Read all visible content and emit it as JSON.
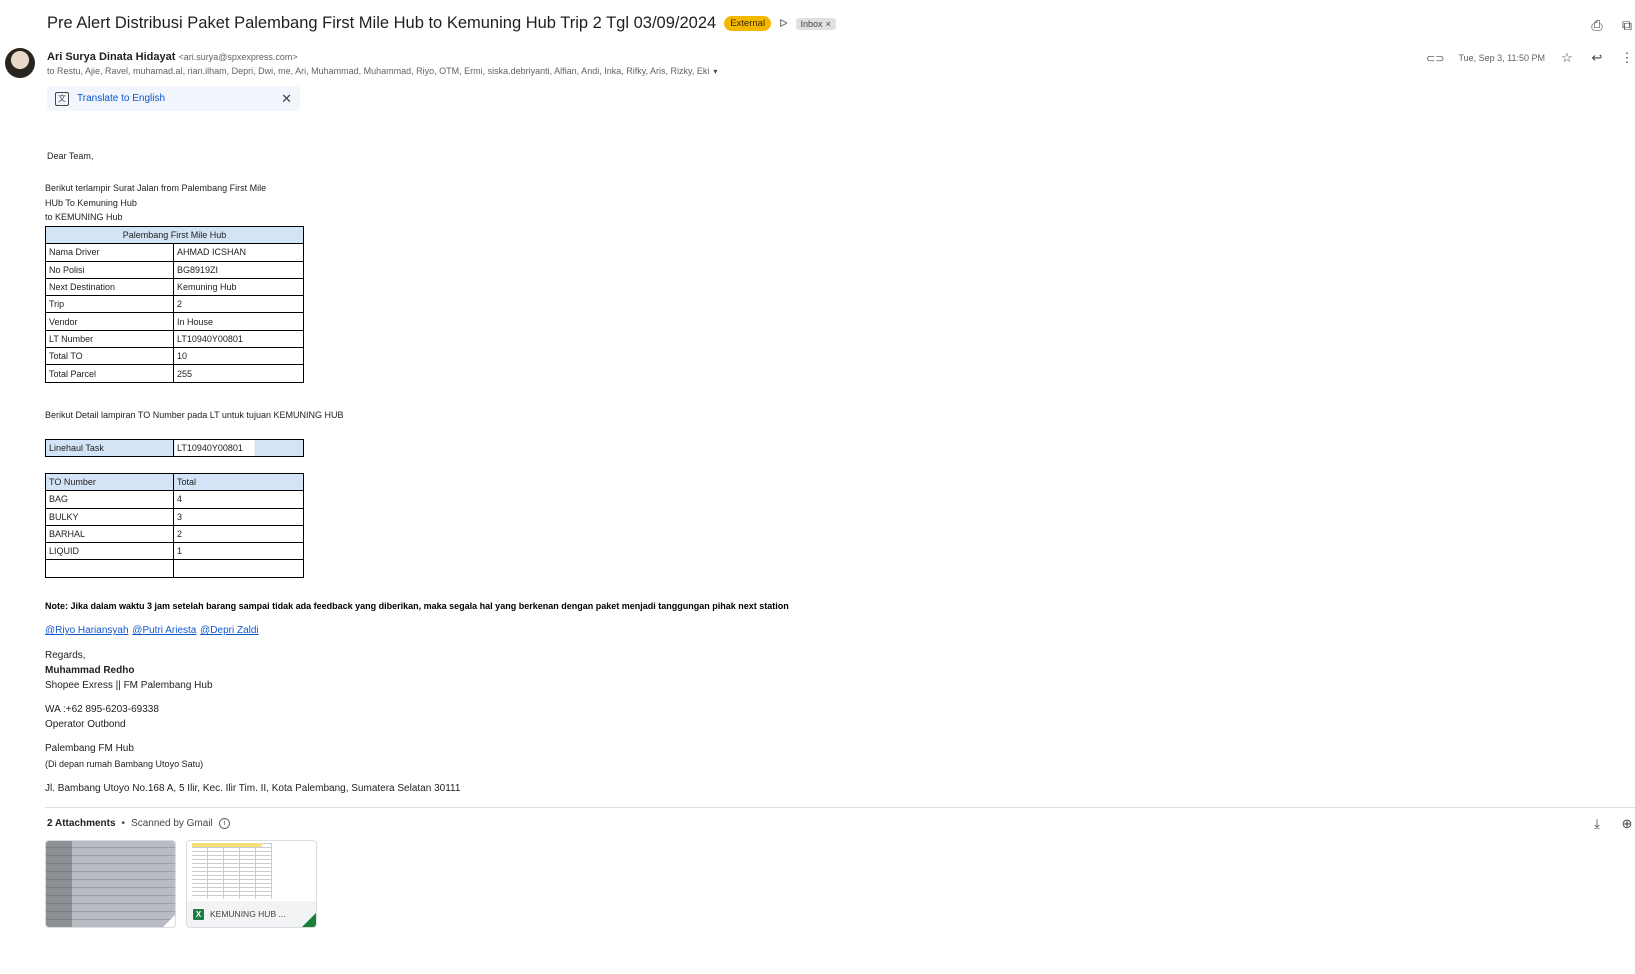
{
  "email": {
    "subject": "Pre Alert Distribusi Paket Palembang First Mile Hub to Kemuning Hub Trip 2 Tgl 03/09/2024",
    "labels": {
      "external": "External",
      "inbox": "Inbox",
      "inbox_close": "×"
    },
    "sender_name": "Ari Surya Dinata Hidayat",
    "sender_email": "<ari.surya@spxexpress.com>",
    "recipients": "to Restu, Ajie, Ravel, muhamad.al, rian.ilham, Depri, Dwi, me, Ari, Muhammad, Muhammad, Riyo, OTM, Ermi, siska.debriyanti, Alfian, Andi, Inka, Rifky, Aris, Rizky, Eki",
    "date": "Tue, Sep 3, 11:50 PM"
  },
  "translate": {
    "label": "Translate to English",
    "close": "✕"
  },
  "body": {
    "greeting": "Dear Team,",
    "intro_lines": [
      "Berikut terlampir Surat Jalan from Palembang First Mile",
      "HUb To Kemuning Hub",
      "to KEMUNING  Hub"
    ],
    "info_table": {
      "header": "Palembang First Mile Hub",
      "rows": [
        {
          "label": "Nama Driver",
          "value": "AHMAD ICSHAN"
        },
        {
          "label": "No Polisi",
          "value": "BG8919ZI"
        },
        {
          "label": "Next Destination",
          "value": "Kemuning Hub"
        },
        {
          "label": "Trip",
          "value": "2"
        },
        {
          "label": "Vendor",
          "value": "In House"
        },
        {
          "label": "LT Number",
          "value": "LT10940Y00801"
        },
        {
          "label": "Total TO",
          "value": "10"
        },
        {
          "label": "Total Parcel",
          "value": "255"
        }
      ]
    },
    "detail_line": "Berikut Detail lampiran TO Number pada LT untuk tujuan KEMUNING HUB",
    "linehaul": {
      "label": "Linehaul Task",
      "value": "LT10940Y00801"
    },
    "to_table": {
      "headers": [
        "TO Number",
        "Total"
      ],
      "rows": [
        {
          "type": "BAG",
          "total": "4"
        },
        {
          "type": "BULKY",
          "total": "3"
        },
        {
          "type": "BARHAL",
          "total": "2"
        },
        {
          "type": "LIQUID",
          "total": "1"
        },
        {
          "type": "",
          "total": ""
        }
      ]
    },
    "note": "Note: Jika dalam waktu 3 jam setelah barang sampai tidak ada feedback yang diberikan, maka segala hal yang berkenan dengan paket menjadi tanggungan pihak next station",
    "mentions": [
      "@Riyo Hariansyah",
      "@Putri Ariesta",
      "@Depri Zaldi"
    ],
    "signature": {
      "regards": "Regards,",
      "name": "Muhammad Redho",
      "company": "Shopee Exress || FM Palembang Hub",
      "wa": "WA :+62 895-6203-69338",
      "role": "Operator Outbond",
      "hub": "Palembang FM Hub",
      "hub_note": "(Di depan rumah Bambang Utoyo Satu)",
      "address": "Jl. Bambang Utoyo No.168 A, 5 Ilir, Kec. Ilir Tim. II, Kota Palembang, Sumatera Selatan 30111"
    }
  },
  "attachments": {
    "count_label": "2 Attachments",
    "scanned": "Scanned by Gmail",
    "files": [
      {
        "name": "",
        "kind": "image"
      },
      {
        "name": "KEMUNING HUB ...",
        "kind": "excel",
        "icon_letter": "X"
      }
    ]
  }
}
